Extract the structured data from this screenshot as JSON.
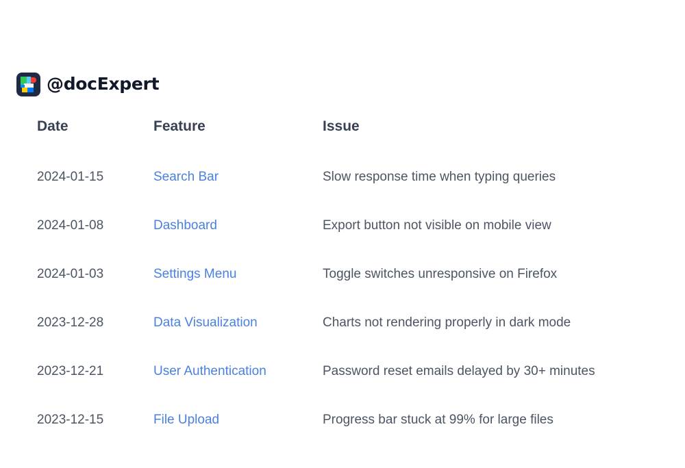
{
  "header": {
    "handle": "@docExpert",
    "logo_icon": "docexpert-logo-icon"
  },
  "table": {
    "columns": [
      "Date",
      "Feature",
      "Issue"
    ],
    "rows": [
      {
        "date": "2024-01-15",
        "feature": "Search Bar",
        "issue": "Slow response time when typing queries"
      },
      {
        "date": "2024-01-08",
        "feature": "Dashboard",
        "issue": "Export button not visible on mobile view"
      },
      {
        "date": "2024-01-03",
        "feature": "Settings Menu",
        "issue": "Toggle switches unresponsive on Firefox"
      },
      {
        "date": "2023-12-28",
        "feature": "Data Visualization",
        "issue": "Charts not rendering properly in dark mode"
      },
      {
        "date": "2023-12-21",
        "feature": "User Authentication",
        "issue": "Password reset emails delayed by 30+ minutes"
      },
      {
        "date": "2023-12-15",
        "feature": "File Upload",
        "issue": "Progress bar stuck at 99% for large files"
      }
    ]
  },
  "colors": {
    "link": "#4a80e0",
    "text": "#4b5563",
    "heading": "#374151"
  }
}
